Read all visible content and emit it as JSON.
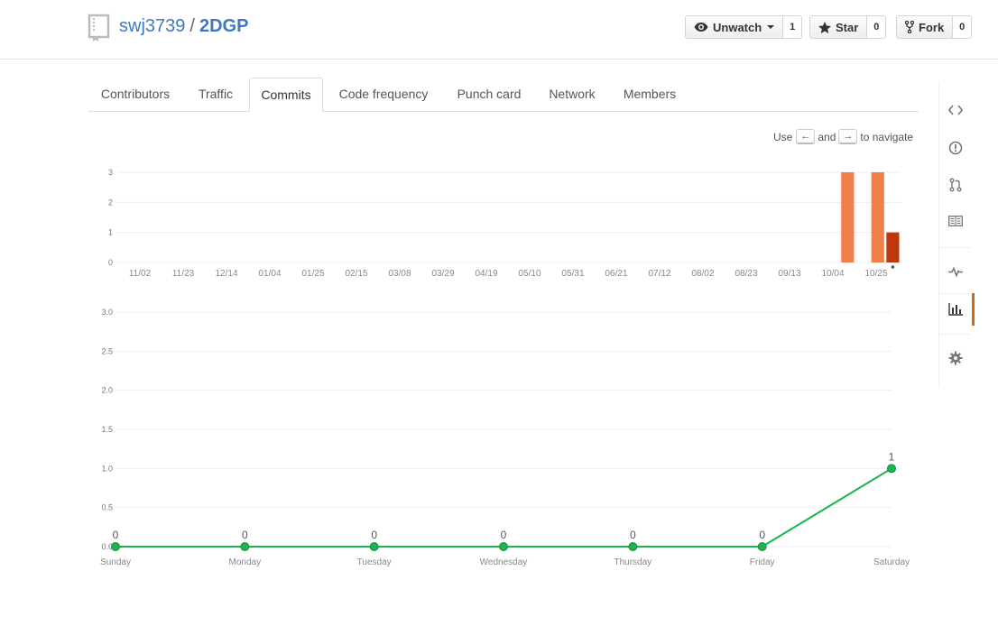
{
  "repo": {
    "owner": "swj3739",
    "separator": "/",
    "name": "2DGP"
  },
  "actions": [
    {
      "label": "Unwatch",
      "count": "1",
      "icon": "eye-icon"
    },
    {
      "label": "Star",
      "count": "0",
      "icon": "star-icon"
    },
    {
      "label": "Fork",
      "count": "0",
      "icon": "fork-icon"
    }
  ],
  "tabs": [
    "Contributors",
    "Traffic",
    "Commits",
    "Code frequency",
    "Punch card",
    "Network",
    "Members"
  ],
  "active_tab": "Commits",
  "nav_hint": {
    "use": "Use",
    "left_key": "←",
    "and": "and",
    "right_key": "→",
    "suffix": "to navigate"
  },
  "sidebar": [
    "code-icon",
    "issue-icon",
    "pull-request-icon",
    "wiki-icon",
    "pulse-icon",
    "graphs-icon",
    "settings-icon"
  ],
  "colors": {
    "bar": "#f17f49",
    "bar_selected": "#bd380f",
    "line": "#1db34f",
    "link": "#4078c0",
    "active_indicator": "#d26911"
  },
  "chart_data": [
    {
      "type": "bar",
      "ylim": [
        0,
        3
      ],
      "yticks": [
        "0",
        "1",
        "2",
        "3"
      ],
      "xticks": [
        "11/02",
        "11/23",
        "12/14",
        "01/04",
        "01/25",
        "02/15",
        "03/08",
        "03/29",
        "04/19",
        "05/10",
        "05/31",
        "06/21",
        "07/12",
        "08/02",
        "08/23",
        "09/13",
        "10/04",
        "10/25"
      ],
      "weeks_total": 52,
      "values": [
        0,
        0,
        0,
        0,
        0,
        0,
        0,
        0,
        0,
        0,
        0,
        0,
        0,
        0,
        0,
        0,
        0,
        0,
        0,
        0,
        0,
        0,
        0,
        0,
        0,
        0,
        0,
        0,
        0,
        0,
        0,
        0,
        0,
        0,
        0,
        0,
        0,
        0,
        0,
        0,
        0,
        0,
        0,
        0,
        0,
        0,
        0,
        0,
        3,
        0,
        3,
        1
      ],
      "selected_index": 51
    },
    {
      "type": "line",
      "categories": [
        "Sunday",
        "Monday",
        "Tuesday",
        "Wednesday",
        "Thursday",
        "Friday",
        "Saturday"
      ],
      "values": [
        0,
        0,
        0,
        0,
        0,
        0,
        1
      ],
      "ylim": [
        0,
        3
      ],
      "yticks": [
        "0.0",
        "0.5",
        "1.0",
        "1.5",
        "2.0",
        "2.5",
        "3.0"
      ]
    }
  ]
}
